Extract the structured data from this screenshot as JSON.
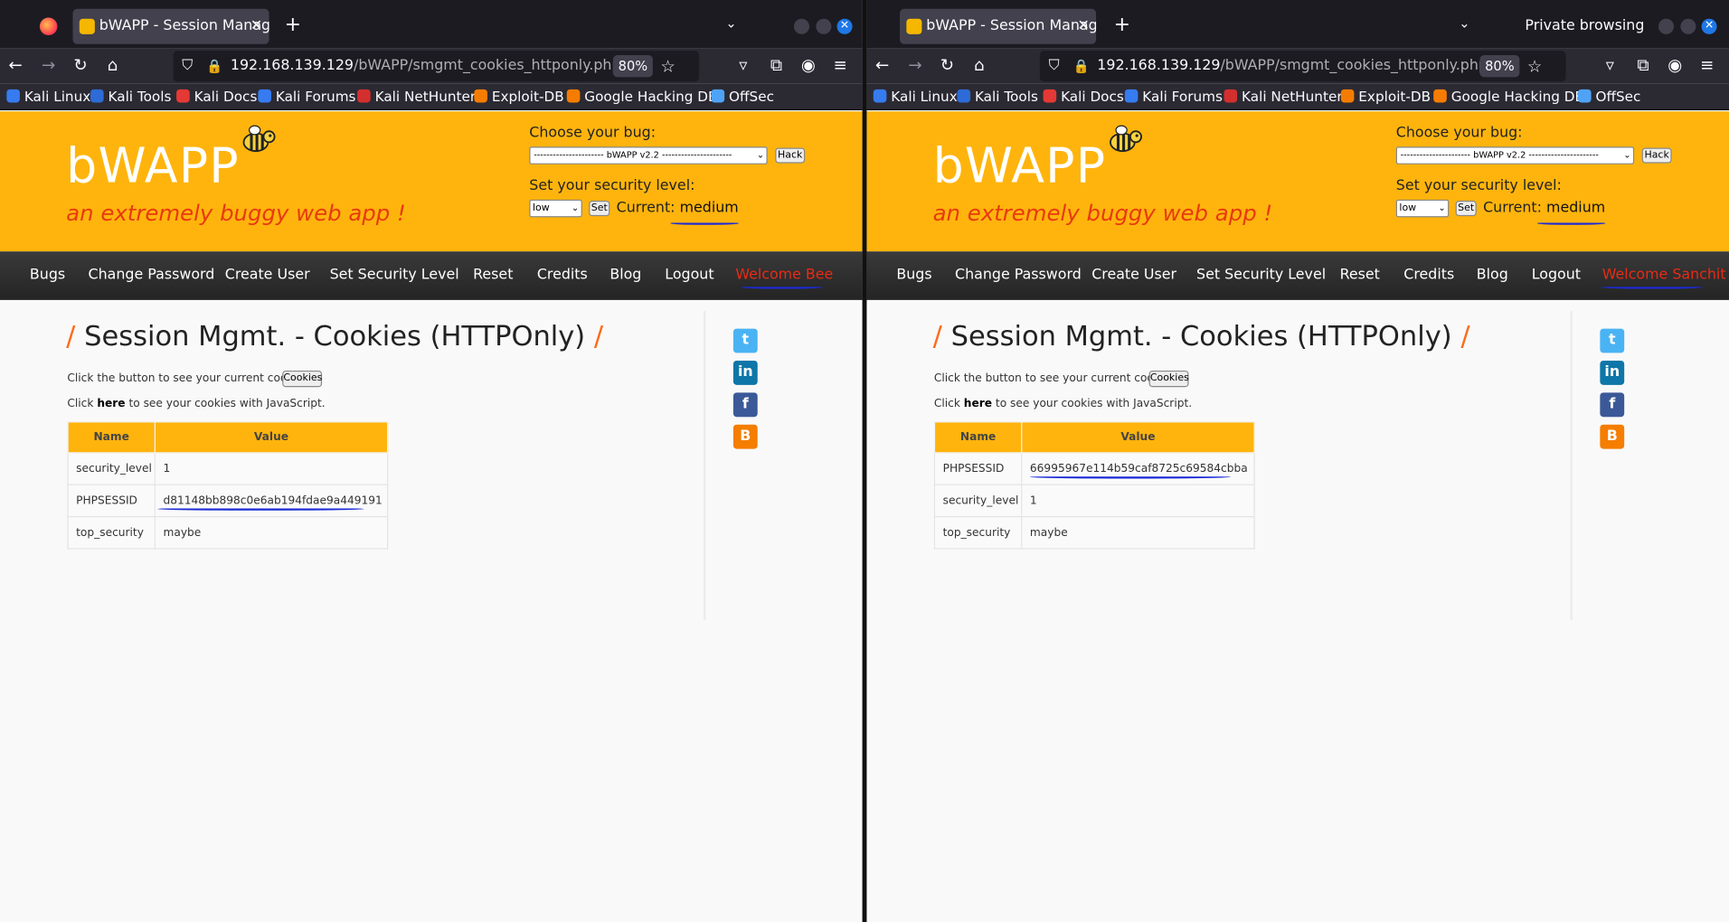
{
  "left": {
    "tab_title": "bWAPP - Session Manage",
    "private_label": "",
    "url_host": "192.168.139.129",
    "url_path": "/bWAPP/smgmt_cookies_httponly.php",
    "zoom": "80%",
    "bookmarks": [
      "Kali Linux",
      "Kali Tools",
      "Kali Docs",
      "Kali Forums",
      "Kali NetHunter",
      "Exploit-DB",
      "Google Hacking DB",
      "OffSec"
    ],
    "logo": "bWAPP",
    "tagline": "an extremely buggy web app !",
    "choose_label": "Choose your bug:",
    "bug_selected": "---------------------- bWAPP v2.2 ----------------------",
    "hack_label": "Hack",
    "security_label": "Set your security level:",
    "level_selected": "low",
    "set_label": "Set",
    "current_label": "Current:",
    "current_value": "medium",
    "menu": [
      "Bugs",
      "Change Password",
      "Create User",
      "Set Security Level",
      "Reset",
      "Credits",
      "Blog",
      "Logout"
    ],
    "welcome": "Welcome Bee",
    "page_title": "Session Mgmt. - Cookies (HTTPOnly)",
    "intro": "Click the button to see your current cookies:",
    "cookies_button": "Cookies",
    "js_pre": "Click",
    "js_link": "here",
    "js_post": "to see your cookies with JavaScript.",
    "col_name": "Name",
    "col_value": "Value",
    "rows": [
      {
        "name": "security_level",
        "value": "1"
      },
      {
        "name": "PHPSESSID",
        "value": "d81148bb898c0e6ab194fdae9a449191"
      },
      {
        "name": "top_security",
        "value": "maybe"
      }
    ]
  },
  "right": {
    "tab_title": "bWAPP - Session Manage",
    "private_label": "Private browsing",
    "url_host": "192.168.139.129",
    "url_path": "/bWAPP/smgmt_cookies_httponly.php",
    "zoom": "80%",
    "bookmarks": [
      "Kali Linux",
      "Kali Tools",
      "Kali Docs",
      "Kali Forums",
      "Kali NetHunter",
      "Exploit-DB",
      "Google Hacking DB",
      "OffSec"
    ],
    "logo": "bWAPP",
    "tagline": "an extremely buggy web app !",
    "choose_label": "Choose your bug:",
    "bug_selected": "---------------------- bWAPP v2.2 ----------------------",
    "hack_label": "Hack",
    "security_label": "Set your security level:",
    "level_selected": "low",
    "set_label": "Set",
    "current_label": "Current:",
    "current_value": "medium",
    "menu": [
      "Bugs",
      "Change Password",
      "Create User",
      "Set Security Level",
      "Reset",
      "Credits",
      "Blog",
      "Logout"
    ],
    "welcome": "Welcome Sanchit",
    "page_title": "Session Mgmt. - Cookies (HTTPOnly)",
    "intro": "Click the button to see your current cookies:",
    "cookies_button": "Cookies",
    "js_pre": "Click",
    "js_link": "here",
    "js_post": "to see your cookies with JavaScript.",
    "col_name": "Name",
    "col_value": "Value",
    "rows": [
      {
        "name": "PHPSESSID",
        "value": "66995967e114b59caf8725c69584cbba"
      },
      {
        "name": "security_level",
        "value": "1"
      },
      {
        "name": "top_security",
        "value": "maybe"
      }
    ]
  },
  "colors": {
    "bwapp_yellow": "#ffb40d",
    "tagline_red": "#e8390e",
    "annotation_blue": "#1a2ad6",
    "browser_dark": "#1c1b22"
  },
  "icons": [
    "firefox-icon",
    "back-icon",
    "forward-icon",
    "reload-icon",
    "home-icon",
    "shield-icon",
    "lock-icon",
    "star-icon",
    "pocket-icon",
    "extensions-icon",
    "account-icon",
    "menu-icon",
    "twitter-icon",
    "linkedin-icon",
    "facebook-icon",
    "blogger-icon",
    "bee-icon"
  ]
}
